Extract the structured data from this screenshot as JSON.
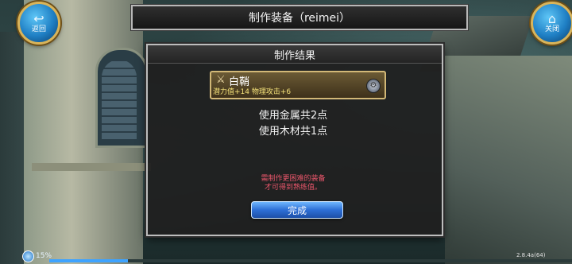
{
  "header": {
    "title": "制作装备（reimei）"
  },
  "buttons": {
    "back_label": "返回",
    "back_icon": "back-arrow-icon",
    "close_label": "关闭",
    "close_icon": "home-icon"
  },
  "dialog": {
    "title": "制作结果",
    "item": {
      "name": "白鞘",
      "stats": "潜力值+14 物理攻击+6",
      "icon": "scabbard-icon",
      "badge_icon": "gear-icon"
    },
    "usage": [
      "使用金属共2点",
      "使用木材共1点"
    ],
    "note": [
      "需制作更困难的装备",
      "才可得到熟练值。"
    ],
    "done_label": "完成"
  },
  "status": {
    "battery": "15%",
    "progress": 0.15,
    "version": "2.8.4a(64)"
  },
  "colors": {
    "accent_blue": "#2d6fd6",
    "gold": "#d2b877",
    "warning": "#e8556a",
    "stat_yellow": "#f5e27a"
  }
}
